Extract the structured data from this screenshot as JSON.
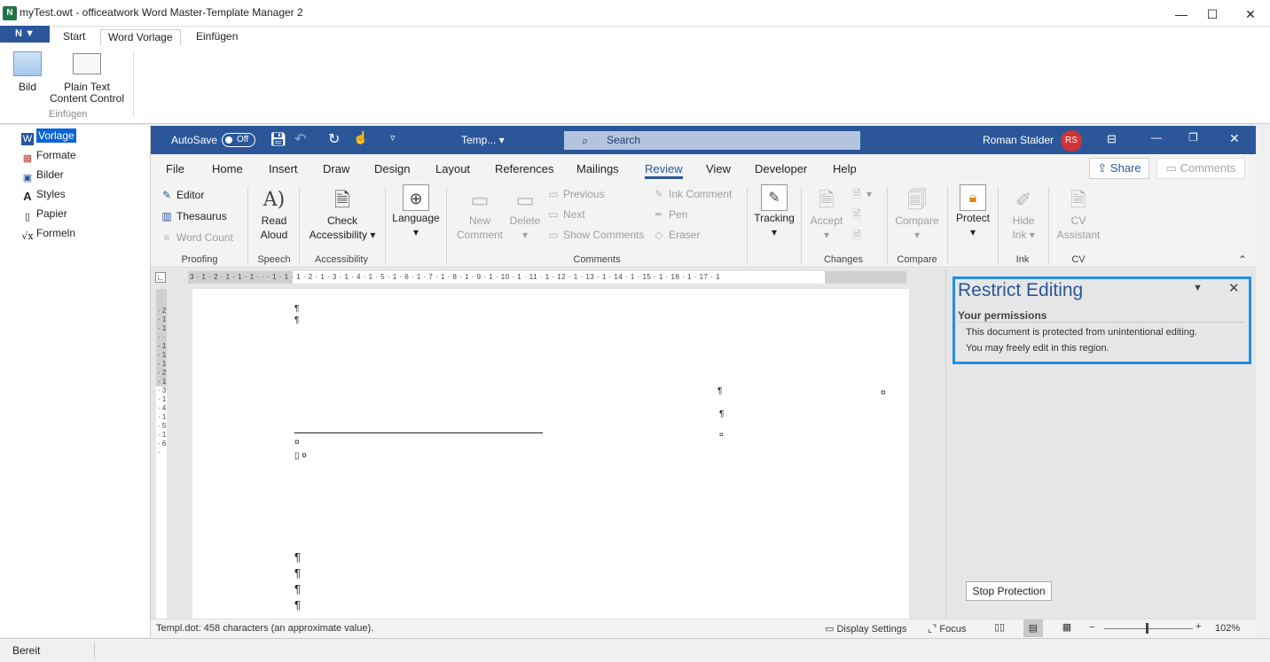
{
  "window": {
    "title": "myTest.owt - officeatwork Word Master-Template Manager 2",
    "minimize": "—",
    "maximize": "☐",
    "close": "✕"
  },
  "outer_ribbon": {
    "app_menu": "▼",
    "tabs": [
      "Start",
      "Word Vorlage",
      "Einfügen"
    ],
    "active_tab": "Word Vorlage",
    "buttons": [
      {
        "label": "Bild",
        "icon": "picture-icon"
      },
      {
        "label": "Plain Text Content Control",
        "icon": "content-control-icon"
      }
    ],
    "group_label": "Einfügen"
  },
  "left_pane": {
    "items": [
      {
        "label": "Vorlage",
        "icon": "word-icon",
        "selected": true
      },
      {
        "label": "Formate",
        "icon": "formats-icon"
      },
      {
        "label": "Bilder",
        "icon": "images-icon"
      },
      {
        "label": "Styles",
        "icon": "styles-icon"
      },
      {
        "label": "Papier",
        "icon": "paper-icon"
      },
      {
        "label": "Formeln",
        "icon": "formula-icon"
      }
    ]
  },
  "word": {
    "autosave_label": "AutoSave",
    "autosave_state": "Off",
    "doc_name": "Temp... ▾",
    "search_placeholder": "Search",
    "user_name": "Roman Stalder",
    "user_initials": "RS",
    "tabs": [
      "File",
      "Home",
      "Insert",
      "Draw",
      "Design",
      "Layout",
      "References",
      "Mailings",
      "Review",
      "View",
      "Developer",
      "Help"
    ],
    "active_tab": "Review",
    "share_label": "Share",
    "comments_label": "Comments",
    "ribbon": {
      "proofing": {
        "editor": "Editor",
        "thesaurus": "Thesaurus",
        "word_count": "Word Count",
        "label": "Proofing"
      },
      "speech": {
        "read_aloud_1": "Read",
        "read_aloud_2": "Aloud",
        "label": "Speech"
      },
      "accessibility": {
        "check_1": "Check",
        "check_2": "Accessibility ▾",
        "label": "Accessibility"
      },
      "language": {
        "label_btn": "Language",
        "arrow": "▾"
      },
      "comments": {
        "new_1": "New",
        "new_2": "Comment",
        "delete": "Delete",
        "previous": "Previous",
        "next": "Next",
        "show_comments": "Show Comments",
        "ink_comment": "Ink Comment",
        "pen": "Pen",
        "eraser": "Eraser",
        "label": "Comments"
      },
      "tracking": {
        "label_btn": "Tracking",
        "arrow": "▾"
      },
      "changes": {
        "accept": "Accept",
        "arrow": "▾",
        "label": "Changes"
      },
      "compare": {
        "label_btn": "Compare",
        "arrow": "▾",
        "label": "Compare"
      },
      "protect": {
        "label_btn": "Protect",
        "arrow": "▾"
      },
      "ink": {
        "hide_1": "Hide",
        "hide_2": "Ink ▾",
        "label": "Ink"
      },
      "cv": {
        "cv_1": "CV",
        "cv_2": "Assistant",
        "label": "CV"
      }
    },
    "ruler_text": "3 · 1 · 2 · 1 · 1 · 1 · · · 1 · 1 · 1 · 2 · 1 · 3 · 1 · 4 · 1 · 5 · 1 · 6 · 1 · 7 · 1 · 8 · 1 · 9 · 1 · 10 · 1 · 11 · 1 · 12 · 1 · 13 · 1 · 14 · 1 · 15 · 1 · 16 · 1 · 17 · 1",
    "vruler_text": "· 2 · 1 · 1 · · · 1 · 1 · 1 · 2 · 1 · 3 · 1 · 4 · 1 · 5 · 1 · 6 ·",
    "restrict": {
      "title": "Restrict Editing",
      "permissions_heading": "Your permissions",
      "line1": "This document is protected from unintentional editing.",
      "line2": "You may freely edit in this region.",
      "stop_button": "Stop Protection"
    },
    "status": {
      "left": "Templ.dot: 458 characters (an approximate value).",
      "display_settings": "Display Settings",
      "focus": "Focus",
      "zoom": "102%"
    }
  },
  "outer_status": "Bereit"
}
